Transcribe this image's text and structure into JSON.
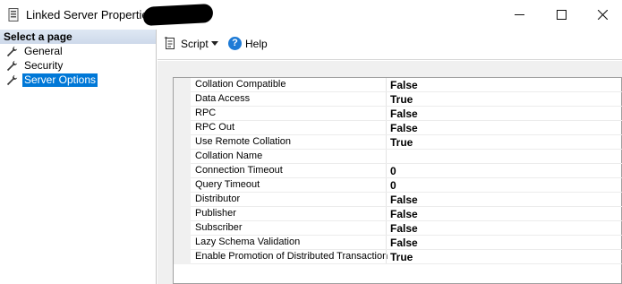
{
  "window": {
    "title": "Linked Server Properties -",
    "minimize_icon": "minimize-icon",
    "maximize_icon": "maximize-icon",
    "close_icon": "close-icon"
  },
  "left_panel": {
    "header": "Select a page",
    "items": [
      {
        "label": "General",
        "icon": "wrench-icon"
      },
      {
        "label": "Security",
        "icon": "wrench-icon"
      },
      {
        "label": "Server Options",
        "icon": "wrench-icon",
        "selected": true
      }
    ]
  },
  "toolbar": {
    "script_label": "Script",
    "help_label": "Help",
    "help_glyph": "?"
  },
  "properties": [
    {
      "name": "Collation Compatible",
      "value": "False"
    },
    {
      "name": "Data Access",
      "value": "True"
    },
    {
      "name": "RPC",
      "value": "False"
    },
    {
      "name": "RPC Out",
      "value": "False"
    },
    {
      "name": "Use Remote Collation",
      "value": "True"
    },
    {
      "name": "Collation Name",
      "value": ""
    },
    {
      "name": "Connection Timeout",
      "value": "0"
    },
    {
      "name": "Query Timeout",
      "value": "0"
    },
    {
      "name": "Distributor",
      "value": "False"
    },
    {
      "name": "Publisher",
      "value": "False"
    },
    {
      "name": "Subscriber",
      "value": "False"
    },
    {
      "name": "Lazy Schema Validation",
      "value": "False"
    },
    {
      "name": "Enable Promotion of Distributed Transaction",
      "value": "True"
    }
  ]
}
